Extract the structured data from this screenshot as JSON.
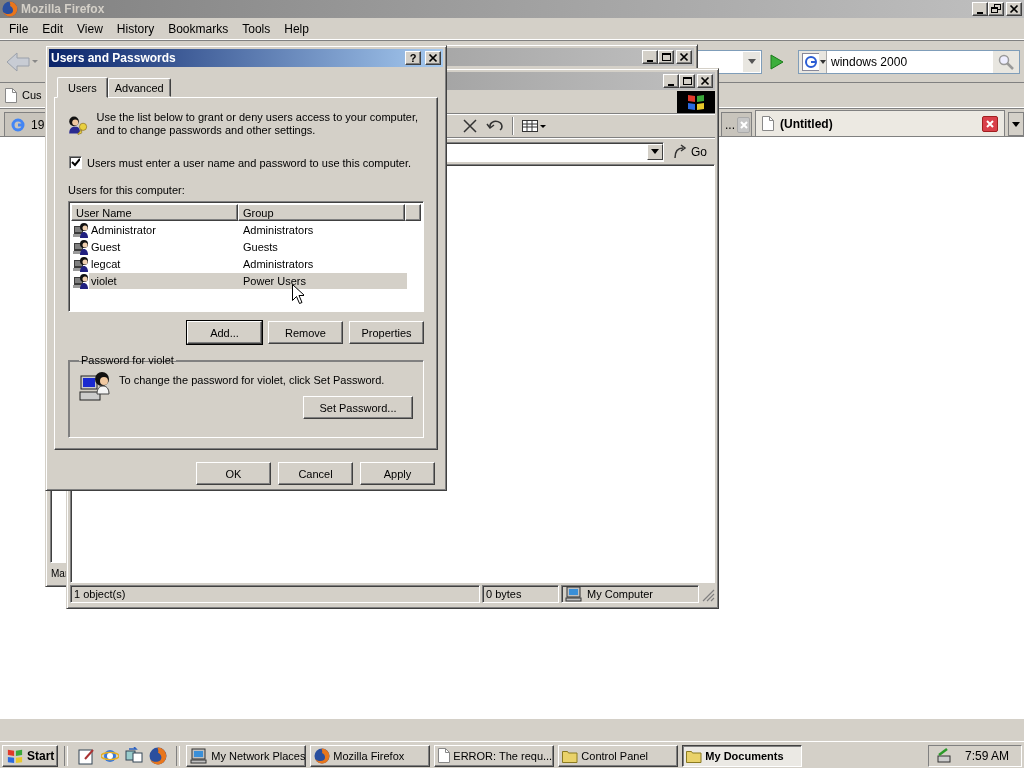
{
  "firefox": {
    "title": "Mozilla Firefox",
    "menu": [
      "File",
      "Edit",
      "View",
      "History",
      "Bookmarks",
      "Tools",
      "Help"
    ],
    "search": {
      "value": "windows 2000"
    },
    "bookmarks": [
      "Cus"
    ],
    "tabs": [
      {
        "label": "19",
        "selected": false
      },
      {
        "label": "...",
        "selected": false
      },
      {
        "label": "(Untitled)",
        "selected": true
      }
    ]
  },
  "control_panel": {
    "pane_label": "Mar"
  },
  "explorer": {
    "go_label": "Go",
    "status": [
      "1 object(s)",
      "0 bytes",
      "My Computer"
    ]
  },
  "dialog": {
    "title": "Users and Passwords",
    "help": "?",
    "tabs": [
      {
        "label": "Users",
        "selected": true
      },
      {
        "label": "Advanced",
        "selected": false
      }
    ],
    "intro": "Use the list below to grant or deny users access to your computer, and to change passwords and other settings.",
    "require_login": {
      "label": "Users must enter a user name and password to use this computer.",
      "checked": true
    },
    "list_label": "Users for this computer:",
    "columns": [
      "User Name",
      "Group"
    ],
    "users": [
      {
        "name": "Administrator",
        "group": "Administrators",
        "selected": false
      },
      {
        "name": "Guest",
        "group": "Guests",
        "selected": false
      },
      {
        "name": "legcat",
        "group": "Administrators",
        "selected": false
      },
      {
        "name": "violet",
        "group": "Power Users",
        "selected": true
      }
    ],
    "list_buttons": [
      "Add...",
      "Remove",
      "Properties"
    ],
    "password": {
      "legend": "Password for violet",
      "text": "To change the password for violet, click Set Password.",
      "button": "Set Password..."
    },
    "buttons": [
      "OK",
      "Cancel",
      "Apply"
    ]
  },
  "taskbar": {
    "start": "Start",
    "tasks": [
      {
        "label": "My Network Places",
        "selected": false
      },
      {
        "label": "Mozilla Firefox",
        "selected": false
      },
      {
        "label": "ERROR: The requ...",
        "selected": false
      },
      {
        "label": "Control Panel",
        "selected": false
      },
      {
        "label": "My Documents",
        "selected": true
      }
    ],
    "clock": "7:59 AM"
  }
}
